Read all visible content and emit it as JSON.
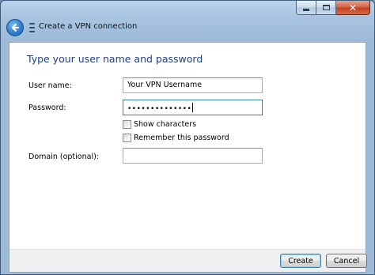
{
  "window": {
    "title": "Create a VPN connection"
  },
  "caption": {
    "close_glyph": "✕"
  },
  "form": {
    "heading": "Type your user name and password",
    "username_label": "User name:",
    "username_value": "Your VPN Username",
    "password_label": "Password:",
    "password_mask": "••••••••••••••",
    "show_characters_label": "Show characters",
    "show_characters_checked": false,
    "remember_password_label": "Remember this password",
    "remember_password_checked": false,
    "domain_label": "Domain (optional):",
    "domain_value": ""
  },
  "buttons": {
    "create": "Create",
    "cancel": "Cancel"
  },
  "colors": {
    "heading": "#1e3f8a",
    "frame": "#9dbbd9",
    "close_button": "#c4401f",
    "back_button": "#2f7fcd"
  },
  "icons": {
    "back": "back-arrow-icon",
    "vpn": "network-icon",
    "minimize": "minimize-icon",
    "maximize": "maximize-icon",
    "close": "close-icon"
  }
}
